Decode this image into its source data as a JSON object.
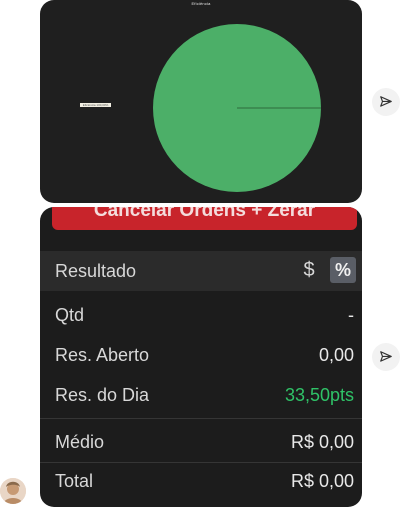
{
  "chart_image": {
    "title": "Eficiência",
    "legend_label": "Eficiência 100,00%",
    "colors": {
      "background": "#1f1f1f",
      "slice": "#4caf68",
      "radius_line": "#2e6b3c"
    },
    "chart_data": {
      "type": "pie",
      "title": "Eficiência",
      "categories": [
        "Eficiência"
      ],
      "values": [
        100
      ]
    }
  },
  "panel": {
    "cancel_button_label": "Cancelar Ordens + Zerar",
    "header": {
      "label": "Resultado",
      "toggle_currency": "$",
      "toggle_percent": "%"
    },
    "rows": [
      {
        "label": "Qtd",
        "value": "-"
      },
      {
        "label": "Res. Aberto",
        "value": "0,00"
      },
      {
        "label": "Res. do Dia",
        "value": "33,50pts"
      },
      {
        "label": "Médio",
        "value": "R$ 0,00"
      },
      {
        "label": "Total",
        "value": "R$ 0,00"
      }
    ],
    "colors": {
      "positive": "#2fc267",
      "cancel_button": "#c8242b",
      "panel_bg": "#1c1c1c"
    }
  },
  "icons": {
    "share": "paper-plane-icon",
    "avatar": "avatar"
  }
}
